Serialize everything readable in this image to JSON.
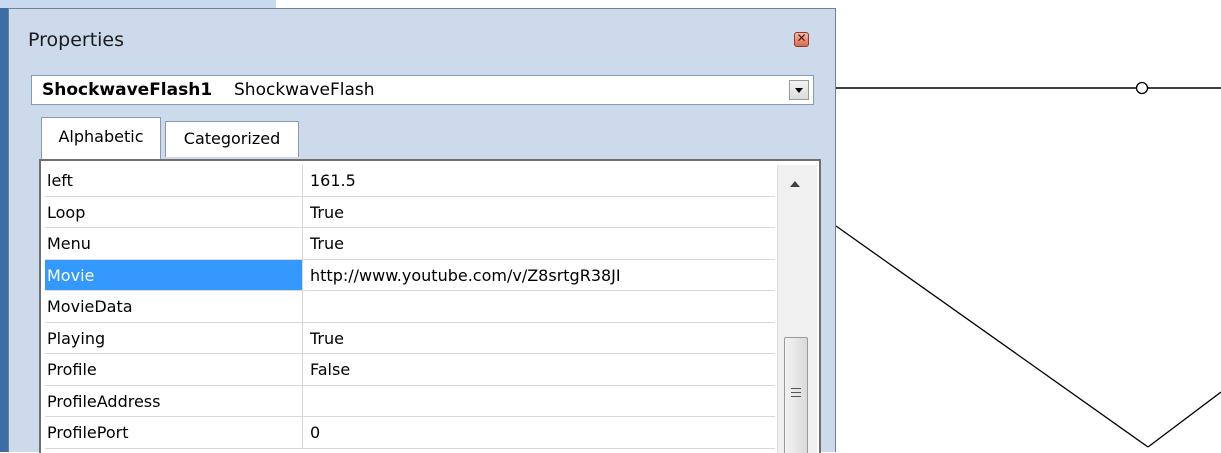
{
  "window": {
    "title": "Properties",
    "close_icon_glyph": "✕"
  },
  "object_selector": {
    "name": "ShockwaveFlash1",
    "type": "ShockwaveFlash"
  },
  "tabs": [
    {
      "label": "Alphabetic",
      "active": true
    },
    {
      "label": "Categorized",
      "active": false
    }
  ],
  "properties": [
    {
      "name": "left",
      "value": "161.5",
      "selected": false
    },
    {
      "name": "Loop",
      "value": "True",
      "selected": false
    },
    {
      "name": "Menu",
      "value": "True",
      "selected": false
    },
    {
      "name": "Movie",
      "value": "http://www.youtube.com/v/Z8srtgR38JI",
      "selected": true
    },
    {
      "name": "MovieData",
      "value": "",
      "selected": false
    },
    {
      "name": "Playing",
      "value": "True",
      "selected": false
    },
    {
      "name": "Profile",
      "value": "False",
      "selected": false
    },
    {
      "name": "ProfileAddress",
      "value": "",
      "selected": false
    },
    {
      "name": "ProfilePort",
      "value": "0",
      "selected": false
    }
  ],
  "colors": {
    "window_bg": "#ccdaeb",
    "selection": "#3399ff",
    "backdrop_blue": "#3a6ea5"
  }
}
